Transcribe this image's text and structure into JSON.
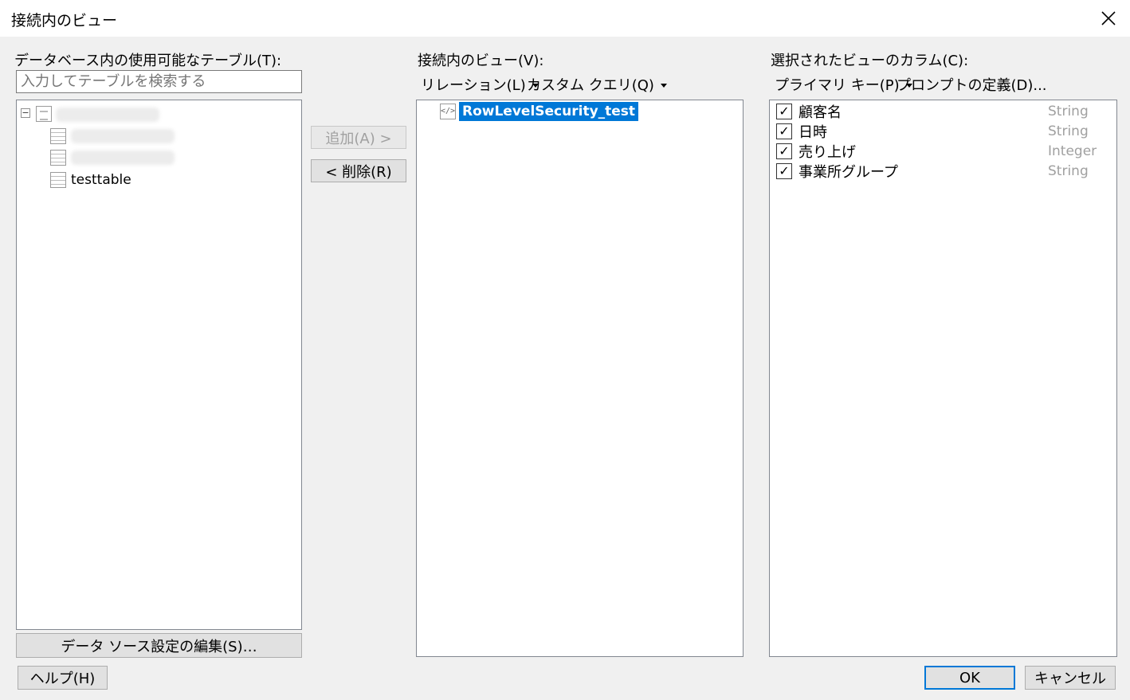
{
  "window": {
    "title": "接続内のビュー"
  },
  "left": {
    "label": "データベース内の使用可能なテーブル(T):",
    "search_placeholder": "入力してテーブルを検索する",
    "tree": {
      "items": [
        {
          "label": "testtable"
        }
      ]
    },
    "edit_button": "データ ソース設定の編集(S)…"
  },
  "middle": {
    "add_button": "追加(A) >",
    "remove_button": "< 削除(R)"
  },
  "views": {
    "label": "接続内のビュー(V):",
    "relation_menu": "リレーション(L)",
    "custom_query_menu": "カスタム クエリ(Q)",
    "items": [
      {
        "label": "RowLevelSecurity_test"
      }
    ]
  },
  "columns": {
    "label": "選択されたビューのカラム(C):",
    "primary_key_menu": "プライマリ キー(P)",
    "prompt_link": "プロンプトの定義(D)...",
    "items": [
      {
        "name": "顧客名",
        "type": "String",
        "checked": true
      },
      {
        "name": "日時",
        "type": "String",
        "checked": true
      },
      {
        "name": "売り上げ",
        "type": "Integer",
        "checked": true
      },
      {
        "name": "事業所グループ",
        "type": "String",
        "checked": true
      }
    ]
  },
  "footer": {
    "help_button": "ヘルプ(H)",
    "ok_button": "OK",
    "cancel_button": "キャンセル"
  },
  "colors": {
    "selection": "#0078d7",
    "background": "#f0f0f0",
    "disabled_text": "#a0a0a0"
  }
}
